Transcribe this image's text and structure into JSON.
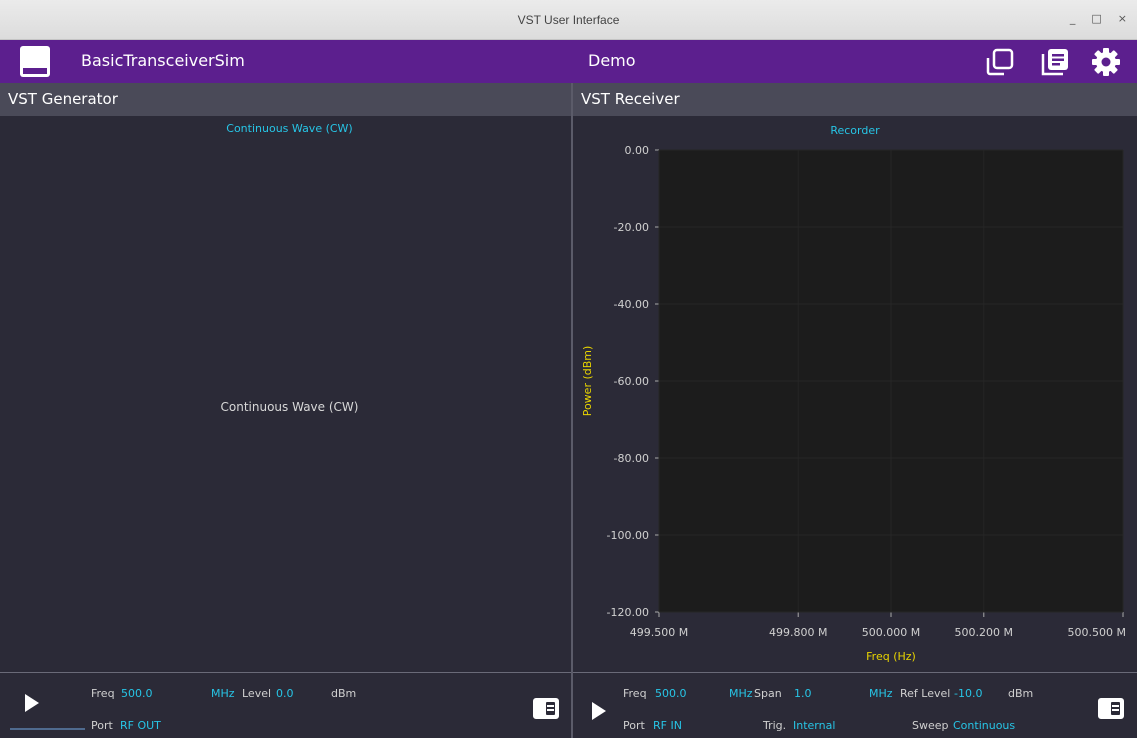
{
  "window": {
    "title": "VST User Interface",
    "minimize": "_",
    "maximize": "□",
    "close": "×"
  },
  "appbar": {
    "name": "BasicTransceiverSim",
    "mode": "Demo",
    "icons": [
      "save-icon",
      "window-swap-icon",
      "log-list-icon",
      "settings-gear-icon"
    ]
  },
  "generator": {
    "header": "VST Generator",
    "plot_title": "Continuous Wave (CW)",
    "center_text": "Continuous Wave (CW)",
    "controls": {
      "freq_label": "Freq",
      "freq_value": "500.0",
      "freq_unit": "MHz",
      "level_label": "Level",
      "level_value": "0.0",
      "level_unit": "dBm",
      "port_label": "Port",
      "port_value": "RF OUT"
    }
  },
  "receiver": {
    "header": "VST Receiver",
    "plot_title": "Recorder",
    "controls": {
      "freq_label": "Freq",
      "freq_value": "500.0",
      "freq_unit": "MHz",
      "span_label": "Span",
      "span_value": "1.0",
      "span_unit": "MHz",
      "ref_label": "Ref Level",
      "ref_value": "-10.0",
      "ref_unit": "dBm",
      "port_label": "Port",
      "port_value": "RF IN",
      "trig_label": "Trig.",
      "trig_value": "Internal",
      "sweep_label": "Sweep",
      "sweep_value": "Continuous"
    }
  },
  "chart_data": {
    "type": "line",
    "title": "Recorder",
    "xlabel": "Freq (Hz)",
    "ylabel": "Power (dBm)",
    "x_ticks": [
      "499.500 M",
      "499.800 M",
      "500.000 M",
      "500.200 M",
      "500.500 M"
    ],
    "x_tick_values": [
      499.5,
      499.8,
      500.0,
      500.2,
      500.5
    ],
    "y_ticks": [
      "0.00",
      "-20.00",
      "-40.00",
      "-60.00",
      "-80.00",
      "-100.00",
      "-120.00"
    ],
    "y_tick_values": [
      0,
      -20,
      -40,
      -60,
      -80,
      -100,
      -120
    ],
    "xlim": [
      499.5,
      500.5
    ],
    "ylim": [
      -120,
      0
    ],
    "series": [],
    "grid": true,
    "colors": {
      "background": "#1c1c1c",
      "axis_label": "#e8d400",
      "tick": "#d0d0d0"
    }
  }
}
